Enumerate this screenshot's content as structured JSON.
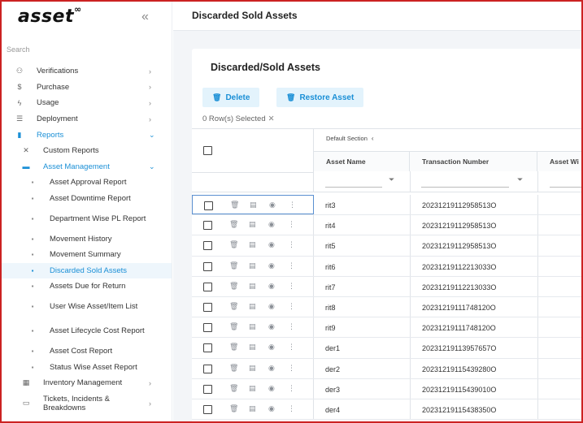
{
  "app": {
    "logo_text": "asset",
    "logo_mark": "∞",
    "collapse_icon": "«",
    "search_placeholder": "Search"
  },
  "sidebar": {
    "items": [
      {
        "label": "Verifications",
        "icon": "user-check-icon",
        "glyph": "⚇",
        "chev": "›"
      },
      {
        "label": "Purchase",
        "icon": "dollar-icon",
        "glyph": "$",
        "chev": "›"
      },
      {
        "label": "Usage",
        "icon": "usage-icon",
        "glyph": "ϟ",
        "chev": "›"
      },
      {
        "label": "Deployment",
        "icon": "deployment-icon",
        "glyph": "☰",
        "chev": "›"
      },
      {
        "label": "Reports",
        "icon": "reports-icon",
        "glyph": "▮",
        "chev": "⌄"
      }
    ],
    "reports_children": [
      {
        "label": "Custom Reports",
        "icon": "tools-icon",
        "glyph": "✕"
      },
      {
        "label": "Asset Management",
        "icon": "folder-icon",
        "glyph": "▬",
        "chev": "⌄"
      }
    ],
    "asset_management_children": [
      "Asset Approval Report",
      "Asset Downtime Report",
      "Department Wise PL Report",
      "Movement History",
      "Movement Summary",
      "Discarded Sold Assets",
      "Assets Due for Return",
      "User Wise Asset/Item List",
      "Asset Lifecycle Cost Report",
      "Asset Cost Report",
      "Status Wise Asset Report"
    ],
    "bottom_items": [
      {
        "label": "Inventory Management",
        "icon": "inventory-icon",
        "glyph": "▦",
        "chev": "›"
      },
      {
        "label": "Tickets, Incidents & Breakdowns",
        "icon": "ticket-icon",
        "glyph": "▭",
        "chev": "›"
      }
    ]
  },
  "header": {
    "title": "Discarded Sold Assets"
  },
  "card": {
    "title": "Discarded/Sold Assets",
    "delete_label": "Delete",
    "restore_label": "Restore Asset",
    "rows_selected": "0 Row(s) Selected",
    "clear_icon": "✕"
  },
  "grid": {
    "section_label": "Default Section",
    "section_nav": "‹",
    "columns": [
      "Asset Name",
      "Transaction Number",
      "Asset Wi"
    ],
    "rows": [
      {
        "name": "rit3",
        "txn": "20231219112958513O"
      },
      {
        "name": "rit4",
        "txn": "20231219112958513O"
      },
      {
        "name": "rit5",
        "txn": "20231219112958513O"
      },
      {
        "name": "rit6",
        "txn": "20231219112213033O"
      },
      {
        "name": "rit7",
        "txn": "20231219112213033O"
      },
      {
        "name": "rit8",
        "txn": "20231219111748120O"
      },
      {
        "name": "rit9",
        "txn": "20231219111748120O"
      },
      {
        "name": "der1",
        "txn": "20231219113957657O"
      },
      {
        "name": "der2",
        "txn": "20231219115439280O"
      },
      {
        "name": "der3",
        "txn": "20231219115439010O"
      },
      {
        "name": "der4",
        "txn": "20231219115438350O"
      }
    ]
  }
}
